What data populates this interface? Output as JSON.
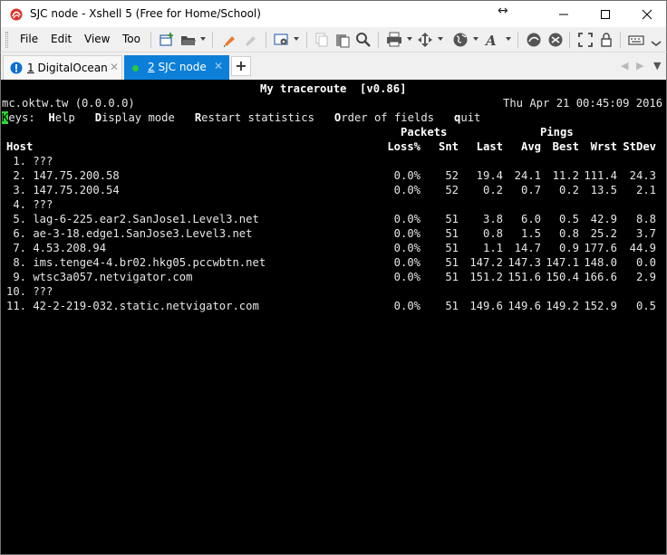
{
  "window": {
    "title": "SJC node - Xshell 5 (Free for Home/School)",
    "minimize_symbol": "—",
    "maximize_symbol": "☐",
    "close_symbol": "✕",
    "resize_symbol": "↔"
  },
  "menu": {
    "file": "File",
    "edit": "Edit",
    "view": "View",
    "tools": "Too"
  },
  "toolbar_icons": [
    "new-session-icon",
    "open-folder-icon",
    "highlighter-icon",
    "eraser-icon",
    "properties-icon",
    "copy-icon",
    "paste-icon",
    "find-icon",
    "print-icon",
    "transfer-icon",
    "globe-icon",
    "font-icon",
    "xftp-icon",
    "xmanager-icon",
    "fullscreen-icon",
    "lock-icon",
    "keyboard-icon",
    "options-icon"
  ],
  "tabs": [
    {
      "number": "1",
      "label": "DigitalOcean",
      "status_icon": "!",
      "close": "✕",
      "active": false
    },
    {
      "number": "2",
      "label": "SJC node",
      "close": "✕",
      "active": true
    }
  ],
  "tab_add": "+",
  "tab_nav": {
    "prev": "◀",
    "next": "▶",
    "menu": "▼"
  },
  "colors": {
    "active_tab": "#0c7fd8",
    "terminal_bg": "#000000",
    "terminal_fg": "#e6e6e6",
    "cursor": "#2ed62e",
    "error_icon": "#0d6fd1"
  },
  "mtr": {
    "title": "My traceroute  [v0.86]",
    "host_line": "mc.oktw.tw (0.0.0.0)",
    "datetime": "Thu Apr 21 00:45:09 2016",
    "keys": {
      "prefix_cursor": "K",
      "prefix_rest": "eys:  ",
      "help_key": "H",
      "help_rest": "elp   ",
      "display_key": "D",
      "display_rest": "isplay mode   ",
      "restart_key": "R",
      "restart_rest": "estart statistics   ",
      "order_key": "O",
      "order_rest": "rder of fields   ",
      "quit_key": "q",
      "quit_rest": "uit"
    },
    "group_headers": {
      "packets": "Packets",
      "pings": "Pings"
    },
    "columns": [
      "Host",
      "Loss%",
      "Snt",
      "Last",
      "Avg",
      "Best",
      "Wrst",
      "StDev"
    ],
    "rows": [
      {
        "host": " 1. ???",
        "loss": "",
        "snt": "",
        "last": "",
        "avg": "",
        "best": "",
        "wrst": "",
        "stdev": ""
      },
      {
        "host": " 2. 147.75.200.58",
        "loss": "0.0%",
        "snt": "52",
        "last": "19.4",
        "avg": "24.1",
        "best": "11.2",
        "wrst": "111.4",
        "stdev": "24.3"
      },
      {
        "host": " 3. 147.75.200.54",
        "loss": "0.0%",
        "snt": "52",
        "last": "0.2",
        "avg": "0.7",
        "best": "0.2",
        "wrst": "13.5",
        "stdev": "2.1"
      },
      {
        "host": " 4. ???",
        "loss": "",
        "snt": "",
        "last": "",
        "avg": "",
        "best": "",
        "wrst": "",
        "stdev": ""
      },
      {
        "host": " 5. lag-6-225.ear2.SanJose1.Level3.net",
        "loss": "0.0%",
        "snt": "51",
        "last": "3.8",
        "avg": "6.0",
        "best": "0.5",
        "wrst": "42.9",
        "stdev": "8.8"
      },
      {
        "host": " 6. ae-3-18.edge1.SanJose3.Level3.net",
        "loss": "0.0%",
        "snt": "51",
        "last": "0.8",
        "avg": "1.5",
        "best": "0.8",
        "wrst": "25.2",
        "stdev": "3.7"
      },
      {
        "host": " 7. 4.53.208.94",
        "loss": "0.0%",
        "snt": "51",
        "last": "1.1",
        "avg": "14.7",
        "best": "0.9",
        "wrst": "177.6",
        "stdev": "44.9"
      },
      {
        "host": " 8. ims.tenge4-4.br02.hkg05.pccwbtn.net",
        "loss": "0.0%",
        "snt": "51",
        "last": "147.2",
        "avg": "147.3",
        "best": "147.1",
        "wrst": "148.0",
        "stdev": "0.0"
      },
      {
        "host": " 9. wtsc3a057.netvigator.com",
        "loss": "0.0%",
        "snt": "51",
        "last": "151.2",
        "avg": "151.6",
        "best": "150.4",
        "wrst": "166.6",
        "stdev": "2.9"
      },
      {
        "host": "10. ???",
        "loss": "",
        "snt": "",
        "last": "",
        "avg": "",
        "best": "",
        "wrst": "",
        "stdev": ""
      },
      {
        "host": "11. 42-2-219-032.static.netvigator.com",
        "loss": "0.0%",
        "snt": "51",
        "last": "149.6",
        "avg": "149.6",
        "best": "149.2",
        "wrst": "152.9",
        "stdev": "0.5"
      }
    ]
  }
}
